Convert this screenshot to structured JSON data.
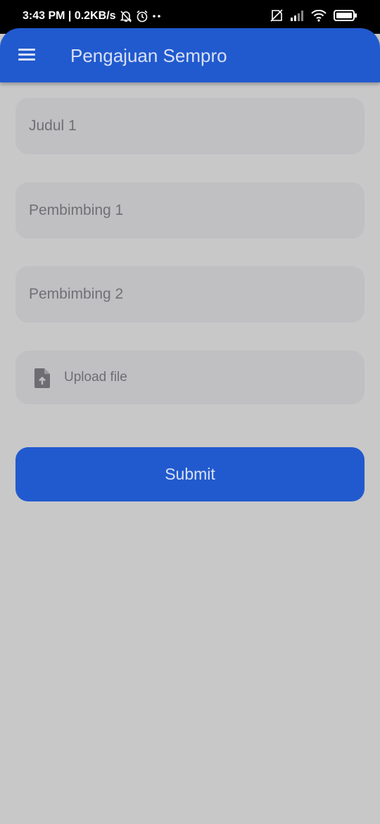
{
  "status_bar": {
    "time_speed": "3:43 PM | 0.2KB/s",
    "icons": [
      "bell-off-icon",
      "alarm-icon",
      "more-dots-icon",
      "no-sim-icon",
      "signal-icon",
      "wifi-icon",
      "battery-icon"
    ]
  },
  "app_bar": {
    "menu_icon": "hamburger-menu-icon",
    "title": "Pengajuan Sempro"
  },
  "form": {
    "judul_placeholder": "Judul 1",
    "pembimbing1_placeholder": "Pembimbing 1",
    "pembimbing2_placeholder": "Pembimbing 2",
    "upload_icon": "file-upload-icon",
    "upload_label": "Upload file",
    "submit_label": "Submit"
  },
  "colors": {
    "primary": "#215ace",
    "background": "#c8c8c9",
    "field_bg": "#c0c0c3"
  }
}
